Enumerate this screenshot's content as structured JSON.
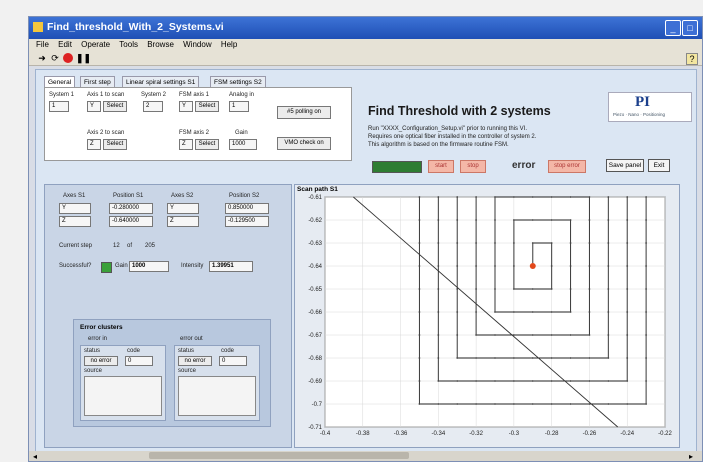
{
  "window": {
    "title": "Find_threshold_With_2_Systems.vi",
    "menu": [
      "File",
      "Edit",
      "Operate",
      "Tools",
      "Browse",
      "Window",
      "Help"
    ]
  },
  "tabs": [
    "General",
    "First step",
    "Linear spiral settings S1",
    "FSM settings S2"
  ],
  "general": {
    "system1_label": "System 1",
    "system1_value": "1",
    "axis1_label": "Axis 1 to scan",
    "axis1_value": "Y",
    "axis2_label": "Axis 2 to scan",
    "axis2_value": "Z",
    "select_label": "Select",
    "system2_label": "System 2",
    "system2_value": "2",
    "fsm_axis1_label": "FSM axis 1",
    "fsm_axis1_value": "Y",
    "fsm_axis2_label": "FSM axis 2",
    "fsm_axis2_value": "Z",
    "analog_in_label": "Analog in",
    "analog_in_value": "1",
    "gain_label": "Gain",
    "gain_value": "1000",
    "polling_button": "#5 polling on",
    "vmo_button": "VMO check on"
  },
  "header": {
    "title": "Find Threshold with 2 systems",
    "logo": "PI",
    "logo_tagline": "Piezo · Nano · Positioning",
    "desc1": "Run \"XXXX_Configuration_Setup.vi\" prior to running this VI.",
    "desc2": "Requires one optical fiber installed in the controller of system 2.",
    "desc3": "This algorithm is based on the firmware routine FSM."
  },
  "controls": {
    "start": "start",
    "stop": "stop",
    "error": "error",
    "stop_error": "stop error",
    "save": "Save panel",
    "exit": "Exit"
  },
  "axes_panel": {
    "axes_s1_label": "Axes S1",
    "position_s1_label": "Position S1",
    "axes_s2_label": "Axes S2",
    "position_s2_label": "Position S2",
    "s1_axes": [
      "Y",
      "Z"
    ],
    "s1_pos": [
      "-0.280000",
      "-0.640000"
    ],
    "s2_axes": [
      "Y",
      "Z"
    ],
    "s2_pos": [
      "0.850000",
      "-0.129500"
    ],
    "current_step_label": "Current step",
    "current_step": "12",
    "of_label": "of",
    "total_steps": "205",
    "successful_label": "Successful?",
    "gain_label": "Gain",
    "gain_value": "1000",
    "intensity_label": "Intensity",
    "intensity_value": "1.39951"
  },
  "errors": {
    "title": "Error clusters",
    "error_in_label": "error in",
    "error_out_label": "error out",
    "status_label": "status",
    "code_label": "code",
    "source_label": "source",
    "in_status": "no error",
    "in_code": "0",
    "out_status": "no error",
    "out_code": "0"
  },
  "chart_data": {
    "type": "line",
    "title": "Scan path S1",
    "xlim": [
      -0.4,
      -0.22
    ],
    "ylim": [
      -0.71,
      -0.61
    ],
    "x_ticks": [
      "-0.4",
      "-0.38",
      "-0.36",
      "-0.34",
      "-0.32",
      "-0.3",
      "-0.28",
      "-0.26",
      "-0.24",
      "-0.22"
    ],
    "y_ticks": [
      "-0.61",
      "-0.62",
      "-0.63",
      "-0.64",
      "-0.65",
      "-0.66",
      "-0.67",
      "-0.68",
      "-0.69",
      "-0.7",
      "-0.71"
    ],
    "spiral_center": [
      -0.29,
      -0.64
    ],
    "diagonal_line": [
      [
        -0.385,
        -0.61
      ],
      [
        -0.245,
        -0.71
      ]
    ],
    "marker": [
      -0.29,
      -0.64
    ],
    "grid": true
  }
}
